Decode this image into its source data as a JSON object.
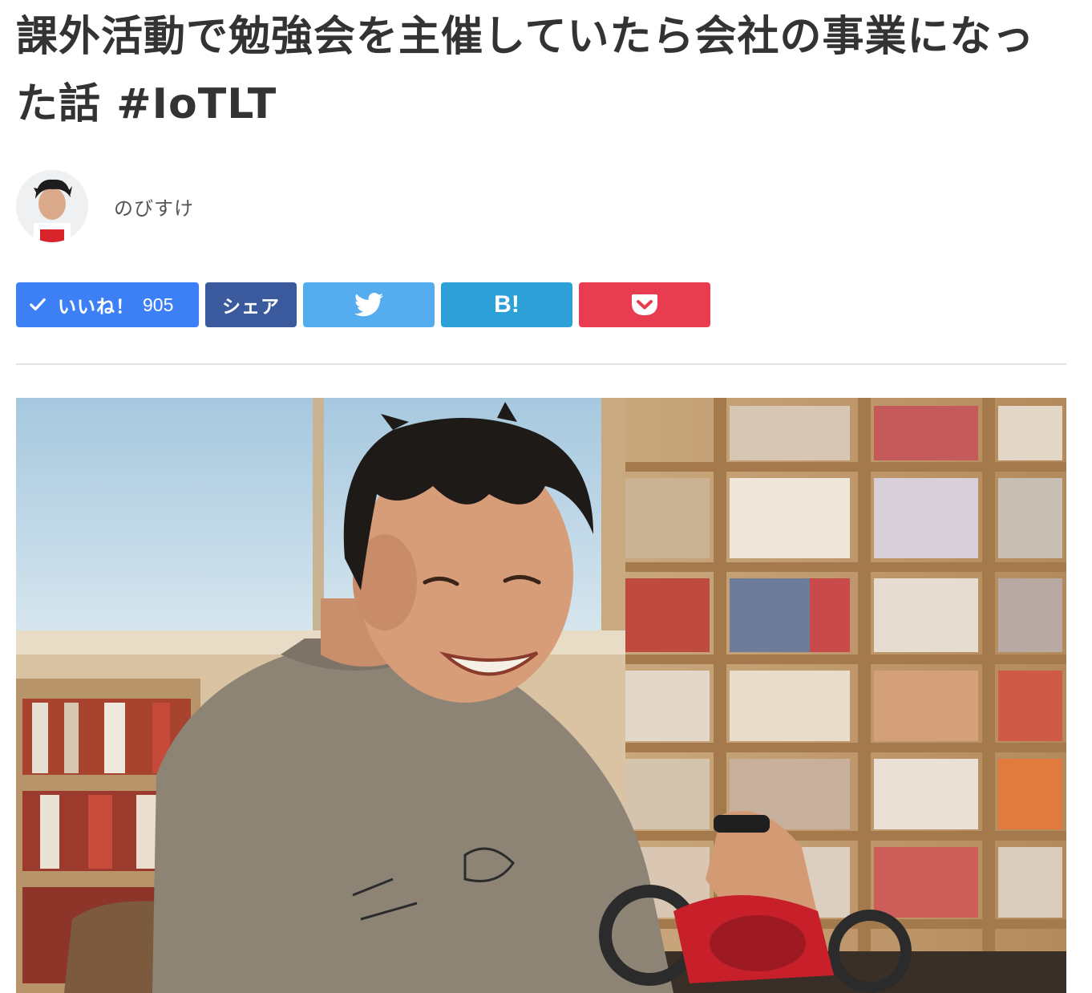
{
  "article": {
    "title": "課外活動で勉強会を主催していたら会社の事業になった話 #IoTLT",
    "author_name": "のびすけ"
  },
  "share_bar": {
    "like_label": "いいね！",
    "like_count": "905",
    "share_label": "シェア",
    "hatena_label": "B!"
  },
  "icons": [
    "check-icon",
    "twitter-bird-icon",
    "pocket-icon"
  ],
  "colors": {
    "like": "#3d7ff4",
    "share": "#3b5a9d",
    "twitter": "#55acee",
    "hatena": "#2da0d8",
    "pocket": "#e83d51"
  }
}
